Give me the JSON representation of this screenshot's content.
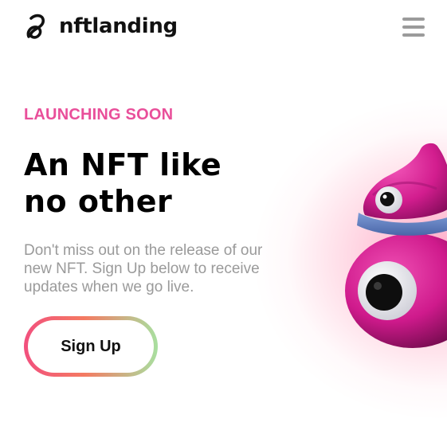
{
  "header": {
    "brand_name": "nftlanding",
    "logo_icon": "swirl-logo-icon",
    "menu_icon": "hamburger-menu-icon"
  },
  "hero": {
    "eyebrow": "LAUNCHING SOON",
    "headline": "An NFT like no other",
    "description": "Don't miss out on the release of our new NFT. Sign Up below to receive updates when we go live.",
    "cta_label": "Sign Up",
    "illustration": "pink-cartoon-creature"
  },
  "colors": {
    "accent_pink": "#e94f9a",
    "headline": "#000000",
    "body_text": "#9a9a9a",
    "button_gradient": [
      "#f2507e",
      "#f47a62",
      "#a8e0a0"
    ],
    "creature_pink": "#d01a8a"
  }
}
